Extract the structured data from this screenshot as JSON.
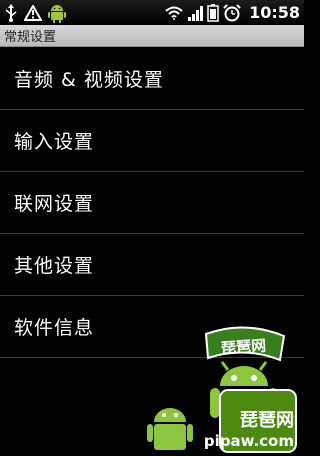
{
  "status_bar": {
    "time": "10:58",
    "icons_left": [
      "usb-icon",
      "warning-icon",
      "android-icon"
    ],
    "icons_right": [
      "wifi-icon",
      "signal-icon",
      "battery-icon",
      "alarm-icon"
    ]
  },
  "title_bar": {
    "title": "常规设置"
  },
  "menu": {
    "items": [
      {
        "label": "音频 & 视频设置"
      },
      {
        "label": "输入设置"
      },
      {
        "label": "联网设置"
      },
      {
        "label": "其他设置"
      },
      {
        "label": "软件信息"
      }
    ]
  },
  "watermark": {
    "banner_text": "琵琶网",
    "text": "琵琶网",
    "url": "pipaw.com",
    "colors": {
      "green": "#8cc63f",
      "dark_green": "#4c8a12",
      "ribbon": "#3a7f1e"
    }
  }
}
